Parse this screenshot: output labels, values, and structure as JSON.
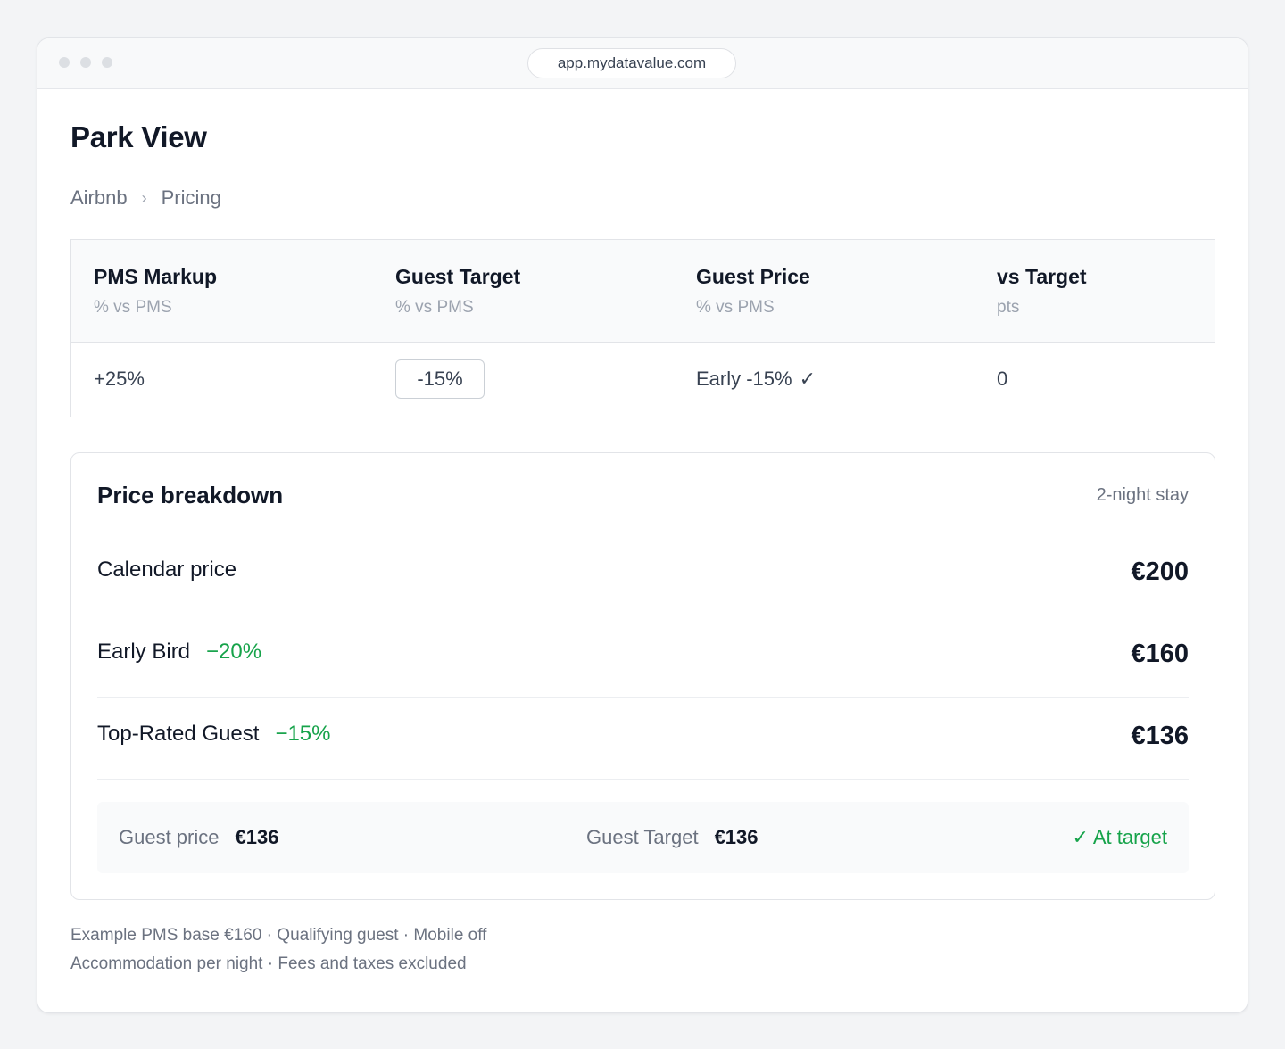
{
  "browser": {
    "url": "app.mydatavalue.com"
  },
  "page": {
    "title": "Park View"
  },
  "breadcrumb": {
    "items": [
      "Airbnb",
      "Pricing"
    ],
    "separator": "›"
  },
  "pricing_table": {
    "columns": [
      {
        "title": "PMS Markup",
        "subtitle": "% vs PMS"
      },
      {
        "title": "Guest Target",
        "subtitle": "% vs PMS"
      },
      {
        "title": "Guest Price",
        "subtitle": "% vs PMS"
      },
      {
        "title": "vs Target",
        "subtitle": "pts"
      }
    ],
    "row": {
      "pms_markup": "+25%",
      "guest_target_value": "-15%",
      "guest_price": "Early -15%",
      "guest_price_check": "✓",
      "vs_target": "0"
    }
  },
  "breakdown": {
    "title": "Price breakdown",
    "stay_note": "2-night stay",
    "lines": [
      {
        "label": "Calendar price",
        "discount": "",
        "amount": "€200"
      },
      {
        "label": "Early Bird",
        "discount": "−20%",
        "amount": "€160"
      },
      {
        "label": "Top-Rated Guest",
        "discount": "−15%",
        "amount": "€136"
      }
    ],
    "summary": {
      "guest_price_label": "Guest price",
      "guest_price_value": "€136",
      "guest_target_label": "Guest Target",
      "guest_target_value": "€136",
      "status": "✓ At target"
    }
  },
  "footnotes": [
    "Example PMS base €160 · Qualifying guest · Mobile off",
    "Accommodation per night · Fees and taxes excluded"
  ],
  "colors": {
    "accent_green": "#16a34a",
    "text_primary": "#111827",
    "text_muted": "#6b7280",
    "border": "#e2e4e8"
  },
  "icons": {
    "check": "check-icon",
    "chevron": "chevron-right-icon"
  }
}
